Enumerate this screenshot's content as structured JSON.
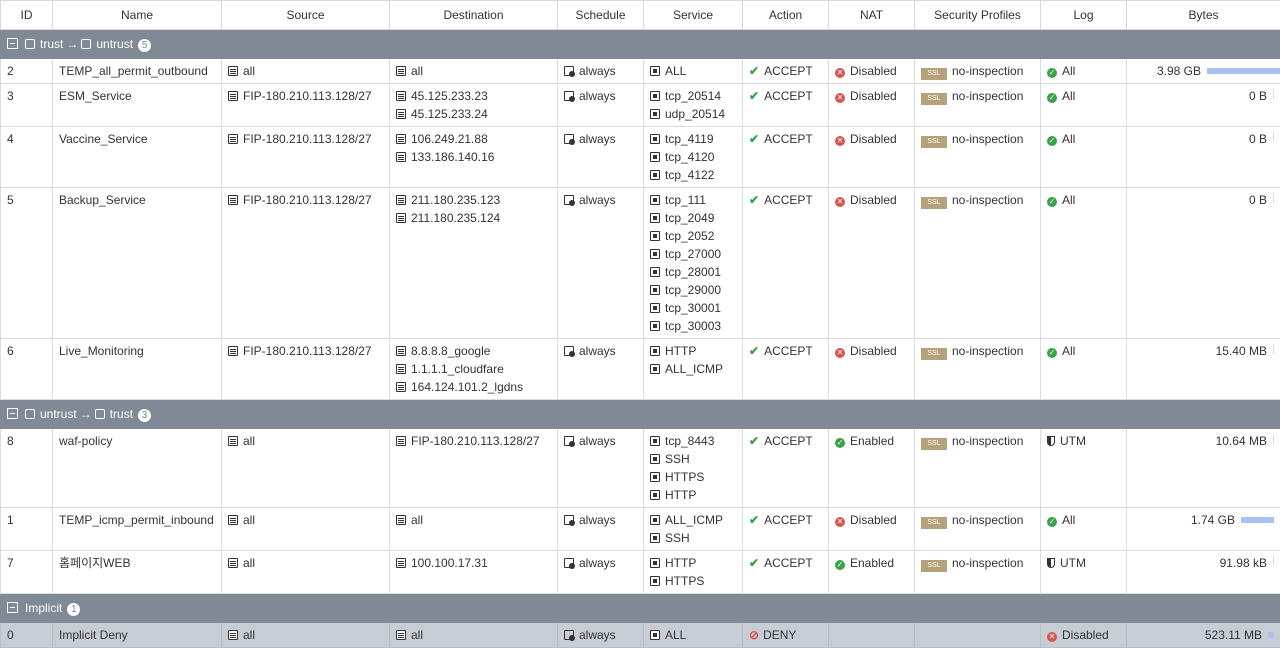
{
  "columns": [
    "ID",
    "Name",
    "Source",
    "Destination",
    "Schedule",
    "Service",
    "Action",
    "NAT",
    "Security Profiles",
    "Log",
    "Bytes"
  ],
  "groups": [
    {
      "from": "trust",
      "to": "untrust",
      "count": "5",
      "rows": [
        {
          "id": "2",
          "name": "TEMP_all_permit_outbound",
          "source": [
            "all"
          ],
          "destination": [
            "all"
          ],
          "schedule": "always",
          "service": [
            "ALL"
          ],
          "action": "ACCEPT",
          "nat": "Disabled",
          "nat_status": "disabled",
          "profile": "no-inspection",
          "log": "All",
          "log_type": "all",
          "bytes": "3.98 GB",
          "bar_fraction": 1.0
        },
        {
          "id": "3",
          "name": "ESM_Service",
          "source": [
            "FIP-180.210.113.128/27"
          ],
          "destination": [
            "45.125.233.23",
            "45.125.233.24"
          ],
          "schedule": "always",
          "service": [
            "tcp_20514",
            "udp_20514"
          ],
          "action": "ACCEPT",
          "nat": "Disabled",
          "nat_status": "disabled",
          "profile": "no-inspection",
          "log": "All",
          "log_type": "all",
          "bytes": "0 B",
          "bar_fraction": 0
        },
        {
          "id": "4",
          "name": "Vaccine_Service",
          "source": [
            "FIP-180.210.113.128/27"
          ],
          "destination": [
            "106.249.21.88",
            "133.186.140.16"
          ],
          "schedule": "always",
          "service": [
            "tcp_4119",
            "tcp_4120",
            "tcp_4122"
          ],
          "action": "ACCEPT",
          "nat": "Disabled",
          "nat_status": "disabled",
          "profile": "no-inspection",
          "log": "All",
          "log_type": "all",
          "bytes": "0 B",
          "bar_fraction": 0
        },
        {
          "id": "5",
          "name": "Backup_Service",
          "source": [
            "FIP-180.210.113.128/27"
          ],
          "destination": [
            "211.180.235.123",
            "211.180.235.124"
          ],
          "schedule": "always",
          "service": [
            "tcp_111",
            "tcp_2049",
            "tcp_2052",
            "tcp_27000",
            "tcp_28001",
            "tcp_29000",
            "tcp_30001",
            "tcp_30003"
          ],
          "action": "ACCEPT",
          "nat": "Disabled",
          "nat_status": "disabled",
          "profile": "no-inspection",
          "log": "All",
          "log_type": "all",
          "bytes": "0 B",
          "bar_fraction": 0
        },
        {
          "id": "6",
          "name": "Live_Monitoring",
          "source": [
            "FIP-180.210.113.128/27"
          ],
          "destination": [
            "8.8.8.8_google",
            "1.1.1.1_cloudfare",
            "164.124.101.2_lgdns"
          ],
          "schedule": "always",
          "service": [
            "HTTP",
            "ALL_ICMP"
          ],
          "action": "ACCEPT",
          "nat": "Disabled",
          "nat_status": "disabled",
          "profile": "no-inspection",
          "log": "All",
          "log_type": "all",
          "bytes": "15.40 MB",
          "bar_fraction": 0
        }
      ]
    },
    {
      "from": "untrust",
      "to": "trust",
      "count": "3",
      "rows": [
        {
          "id": "8",
          "name": "waf-policy",
          "source": [
            "all"
          ],
          "destination": [
            "FIP-180.210.113.128/27"
          ],
          "schedule": "always",
          "service": [
            "tcp_8443",
            "SSH",
            "HTTPS",
            "HTTP"
          ],
          "action": "ACCEPT",
          "nat": "Enabled",
          "nat_status": "enabled",
          "profile": "no-inspection",
          "log": "UTM",
          "log_type": "utm",
          "bytes": "10.64 MB",
          "bar_fraction": 0
        },
        {
          "id": "1",
          "name": "TEMP_icmp_permit_inbound",
          "source": [
            "all"
          ],
          "destination": [
            "all"
          ],
          "schedule": "always",
          "service": [
            "ALL_ICMP",
            "SSH"
          ],
          "action": "ACCEPT",
          "nat": "Disabled",
          "nat_status": "disabled",
          "profile": "no-inspection",
          "log": "All",
          "log_type": "all",
          "bytes": "1.74 GB",
          "bar_fraction": 0.44
        },
        {
          "id": "7",
          "name": "홈페이지WEB",
          "source": [
            "all"
          ],
          "destination": [
            "100.100.17.31"
          ],
          "schedule": "always",
          "service": [
            "HTTP",
            "HTTPS"
          ],
          "action": "ACCEPT",
          "nat": "Enabled",
          "nat_status": "enabled",
          "profile": "no-inspection",
          "log": "UTM",
          "log_type": "utm",
          "bytes": "91.98 kB",
          "bar_fraction": 0
        }
      ]
    }
  ],
  "implicit": {
    "label": "Implicit",
    "count": "1",
    "row": {
      "id": "0",
      "name": "Implicit Deny",
      "source": "all",
      "destination": "all",
      "schedule": "always",
      "service": "ALL",
      "action": "DENY",
      "log": "Disabled",
      "bytes": "523.11 MB",
      "bar_fraction": 0.02
    }
  },
  "colors": {
    "accent_bar": "#a9c0f0",
    "group_header": "#7f8a96",
    "ssl_badge": "#b7a17b"
  },
  "ssl_badge_text": "SSL"
}
